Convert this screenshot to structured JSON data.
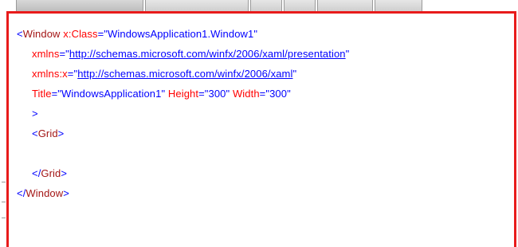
{
  "editor": {
    "tabs": [
      {
        "label": ""
      },
      {
        "label": ""
      },
      {
        "label": ""
      },
      {
        "label": ""
      },
      {
        "label": ""
      },
      {
        "label": ""
      }
    ]
  },
  "code": {
    "line1": {
      "open": "<",
      "element": "Window",
      "attr_name": "x:Class",
      "eq": "=",
      "attr_value": "\"WindowsApplication1.Window1\""
    },
    "line2": {
      "attr_name": "xmlns",
      "eq": "=",
      "quote_open": "\"",
      "url": "http://schemas.microsoft.com/winfx/2006/xaml/presentation",
      "quote_close": "\""
    },
    "line3": {
      "attr_name": "xmlns:x",
      "eq": "=",
      "quote_open": "\"",
      "url": "http://schemas.microsoft.com/winfx/2006/xaml",
      "quote_close": "\""
    },
    "line4": {
      "title_name": "Title",
      "eq1": "=",
      "title_value": "\"WindowsApplication1\"",
      "height_name": "Height",
      "eq2": "=",
      "height_value": "\"300\"",
      "width_name": "Width",
      "eq3": "=",
      "width_value": "\"300\""
    },
    "line5": {
      "close": ">"
    },
    "line6": {
      "open": "<",
      "element": "Grid",
      "close": ">"
    },
    "line8": {
      "open": "</",
      "element": "Grid",
      "close": ">"
    },
    "line9": {
      "open": "</",
      "element": "Window",
      "close": ">"
    }
  },
  "colors": {
    "border": "#e81b1b",
    "tag": "#0000ff",
    "element": "#a31515",
    "attribute": "#ff0000"
  }
}
